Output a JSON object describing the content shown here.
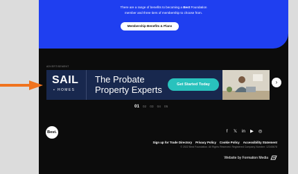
{
  "promo": {
    "text_line1_pre": "There are a range of benefits to becoming a ",
    "text_line1_bold": "Best",
    "text_line1_post": " Foundation",
    "text_line2": "member and three tiers of membership to choose from.",
    "button_label": "Membership Benefits & Plans"
  },
  "advert": {
    "label": "ADVERTISEMENT",
    "brand": "SAIL",
    "brand_sub": "HOMES",
    "headline_1": "The Probate",
    "headline_2": "Property Experts",
    "cta_label": "Get Started Today",
    "next_arrow": "›"
  },
  "carousel": {
    "pages": [
      "01",
      "02",
      "03",
      "04",
      "05"
    ],
    "active_index": 0
  },
  "footer": {
    "logo_text": "Best.",
    "social": [
      {
        "icon": "facebook-icon",
        "glyph": "f"
      },
      {
        "icon": "twitter-icon",
        "glyph": "𝕏"
      },
      {
        "icon": "linkedin-icon",
        "glyph": "in"
      },
      {
        "icon": "youtube-icon",
        "glyph": "▶"
      },
      {
        "icon": "instagram-icon",
        "glyph": "◎"
      }
    ],
    "links": [
      "Sign up for Trade Directory",
      "Privacy Policy",
      "Cookie Policy",
      "Accessibility Statement"
    ],
    "copyright": "© 2022 Best Foundation. All Rights Reserved. Registered Company Number: 12345678",
    "credit": "Website by Formation Media"
  },
  "colors": {
    "promo_bg": "#1f3ff0",
    "footer_bg": "#0c0c0c",
    "banner_bg": "#18284e",
    "cta_bg": "#29c2bd",
    "pointer_arrow": "#f0731e"
  }
}
